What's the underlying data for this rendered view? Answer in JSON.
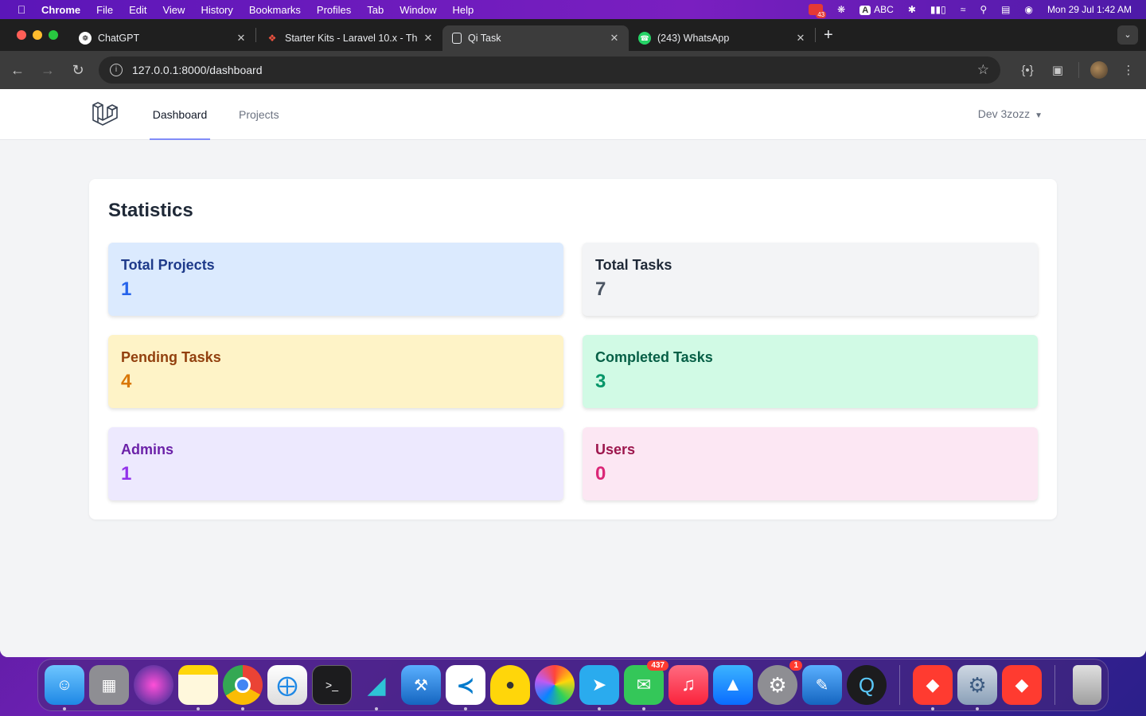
{
  "menubar": {
    "app_name": "Chrome",
    "menus": [
      "File",
      "Edit",
      "View",
      "History",
      "Bookmarks",
      "Profiles",
      "Tab",
      "Window",
      "Help"
    ],
    "notification_count": "43",
    "input_source": "ABC",
    "clock": "Mon 29 Jul  1:42 AM"
  },
  "browser": {
    "tabs": [
      {
        "label": "ChatGPT",
        "favicon": "chatgpt-icon"
      },
      {
        "label": "Starter Kits - Laravel 10.x - Th",
        "favicon": "laravel-icon"
      },
      {
        "label": "Qi Task",
        "favicon": "page-icon",
        "active": true
      },
      {
        "label": "(243) WhatsApp",
        "favicon": "whatsapp-icon"
      }
    ],
    "url": "127.0.0.1:8000/dashboard"
  },
  "app": {
    "nav": {
      "dashboard": "Dashboard",
      "projects": "Projects"
    },
    "user_name": "Dev 3zozz",
    "section_title": "Statistics",
    "stats": [
      {
        "title": "Total Projects",
        "value": "1",
        "color": "#dbeafe"
      },
      {
        "title": "Total Tasks",
        "value": "7",
        "color": "#f3f4f6"
      },
      {
        "title": "Pending Tasks",
        "value": "4",
        "color": "#fef3c7"
      },
      {
        "title": "Completed Tasks",
        "value": "3",
        "color": "#d1fae5"
      },
      {
        "title": "Admins",
        "value": "1",
        "color": "#ede9fe"
      },
      {
        "title": "Users",
        "value": "0",
        "color": "#fce7f3"
      }
    ]
  },
  "dock": {
    "messages_badge": "437",
    "settings_badge": "1"
  }
}
